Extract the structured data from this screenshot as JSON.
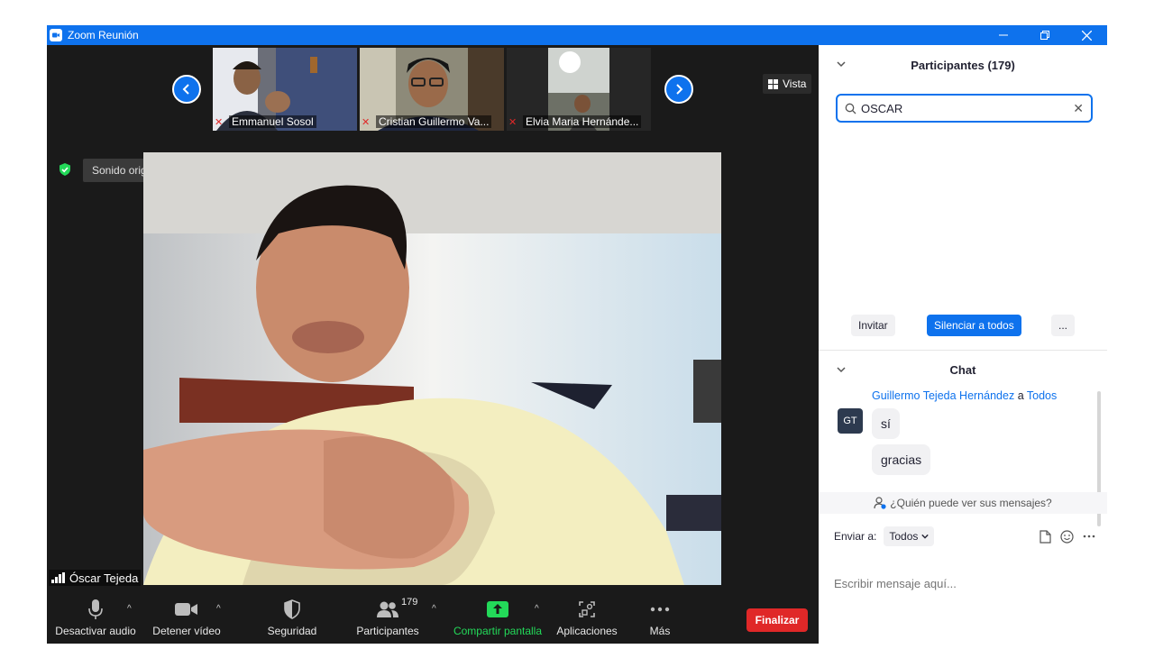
{
  "window": {
    "title": "Zoom Reunión",
    "controls": [
      "minimize-icon",
      "restore-icon",
      "close-icon"
    ]
  },
  "gallery": {
    "participants": [
      {
        "name": "Emmanuel Sosol",
        "muted": true
      },
      {
        "name": "Cristian Guillermo Va...",
        "muted": true
      },
      {
        "name": "Elvia Maria Hernánde...",
        "muted": true
      }
    ]
  },
  "view_button": {
    "label": "Vista"
  },
  "sound": {
    "label": "Sonido original: desactivado"
  },
  "speaker": {
    "name": "Óscar Tejeda"
  },
  "toolbar": {
    "audio": "Desactivar audio",
    "video": "Detener vídeo",
    "security": "Seguridad",
    "participants": "Participantes",
    "participants_count": "179",
    "share": "Compartir pantalla",
    "apps": "Aplicaciones",
    "more": "Más",
    "end": "Finalizar"
  },
  "panel": {
    "participants_title": "Participantes (179)",
    "search_value": "OSCAR",
    "invite": "Invitar",
    "mute_all": "Silenciar a todos",
    "more": "...",
    "chat_title": "Chat",
    "message": {
      "from": "Guillermo Tejeda Hernández",
      "connector": "a",
      "to": "Todos",
      "initials": "GT",
      "lines": [
        "sí",
        "gracias"
      ]
    },
    "who_sees": "¿Quién puede ver sus mensajes?",
    "send_to_label": "Enviar a:",
    "send_to_value": "Todos",
    "input_placeholder": "Escribir mensaje aquí..."
  },
  "colors": {
    "accent": "#0e72ed",
    "end": "#e02828",
    "share": "#23d959",
    "bg": "#1a1a1a"
  }
}
